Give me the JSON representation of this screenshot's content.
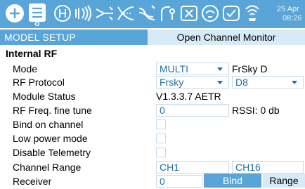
{
  "topbar": {
    "icons": [
      "plus-circle-icon",
      "menu-list-icon",
      "helicopter-h-icon",
      "radio-waves-icon",
      "mixer-icon",
      "crossed-curves-icon",
      "curves-icon",
      "logic-switch-icon",
      "special-function-icon",
      "telemetry-gear-icon",
      "checklist-icon",
      "telemetry-signal-icon"
    ],
    "date_day": "25 Apr",
    "time": "08:26",
    "accent": "#5aa5d7"
  },
  "header": {
    "title": "MODEL SETUP",
    "channel_monitor_button": "Open Channel Monitor"
  },
  "section": {
    "title": "Internal RF"
  },
  "rows": {
    "mode": {
      "label": "Mode",
      "value": "MULTI",
      "sub_value": "FrSky D"
    },
    "rf_protocol": {
      "label": "RF Protocol",
      "value": "Frsky",
      "sub_value": "D8"
    },
    "module_status": {
      "label": "Module Status",
      "value": "V1.3.3.7 AETR"
    },
    "rf_freq": {
      "label": "RF Freq. fine tune",
      "value": "0",
      "rssi": "RSSI: 0 db"
    },
    "bind_on_channel": {
      "label": "Bind on channel"
    },
    "low_power": {
      "label": "Low power mode"
    },
    "disable_telemetry": {
      "label": "Disable Telemetry"
    },
    "channel_range": {
      "label": "Channel Range",
      "start": "CH1",
      "end": "CH16"
    },
    "receiver": {
      "label": "Receiver",
      "value": "0",
      "bind_button": "Bind",
      "range_button": "Range"
    }
  }
}
